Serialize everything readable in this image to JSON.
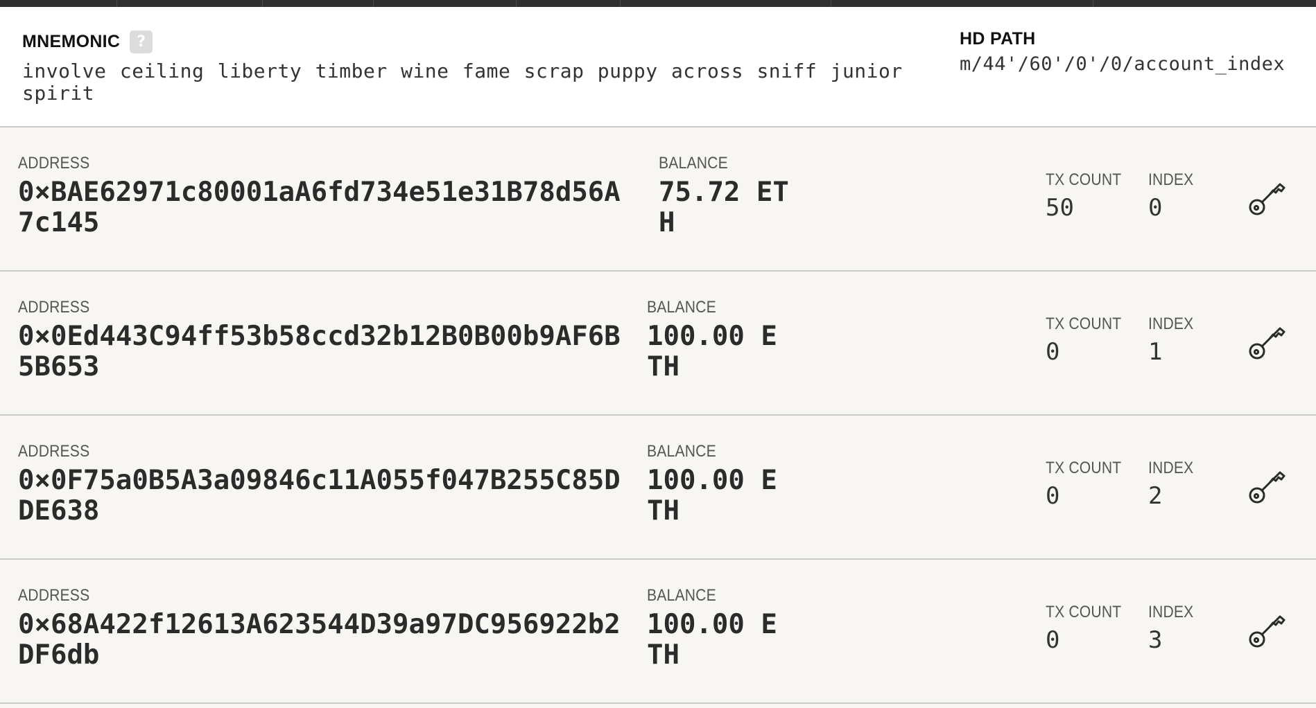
{
  "mnemonic": {
    "label": "MNEMONIC",
    "help_icon_text": "?",
    "words": "involve ceiling liberty timber wine fame scrap puppy across sniff junior spirit"
  },
  "hd_path": {
    "label": "HD PATH",
    "value": "m/44'/60'/0'/0/account_index"
  },
  "labels": {
    "address": "ADDRESS",
    "balance": "BALANCE",
    "tx_count": "TX COUNT",
    "index": "INDEX"
  },
  "accounts": [
    {
      "address": "0×BAE62971c80001aA6fd734e51e31B78d56A7c145",
      "balance": "75.72 ETH",
      "tx_count": "50",
      "index": "0"
    },
    {
      "address": "0×0Ed443C94ff53b58ccd32b12B0B00b9AF6B5B653",
      "balance": "100.00 ETH",
      "tx_count": "0",
      "index": "1"
    },
    {
      "address": "0×0F75a0B5A3a09846c11A055f047B255C85DDE638",
      "balance": "100.00 ETH",
      "tx_count": "0",
      "index": "2"
    },
    {
      "address": "0×68A422f12613A623544D39a97DC956922b2DF6db",
      "balance": "100.00 ETH",
      "tx_count": "0",
      "index": "3"
    }
  ],
  "icons": {
    "help": "question-mark-icon",
    "key": "key-icon"
  },
  "colors": {
    "background": "#f7f6f3",
    "panel": "#ffffff",
    "topbar": "#2f2f2f",
    "divider": "#c9c9c9",
    "help_icon_bg": "#dcdcdc"
  }
}
